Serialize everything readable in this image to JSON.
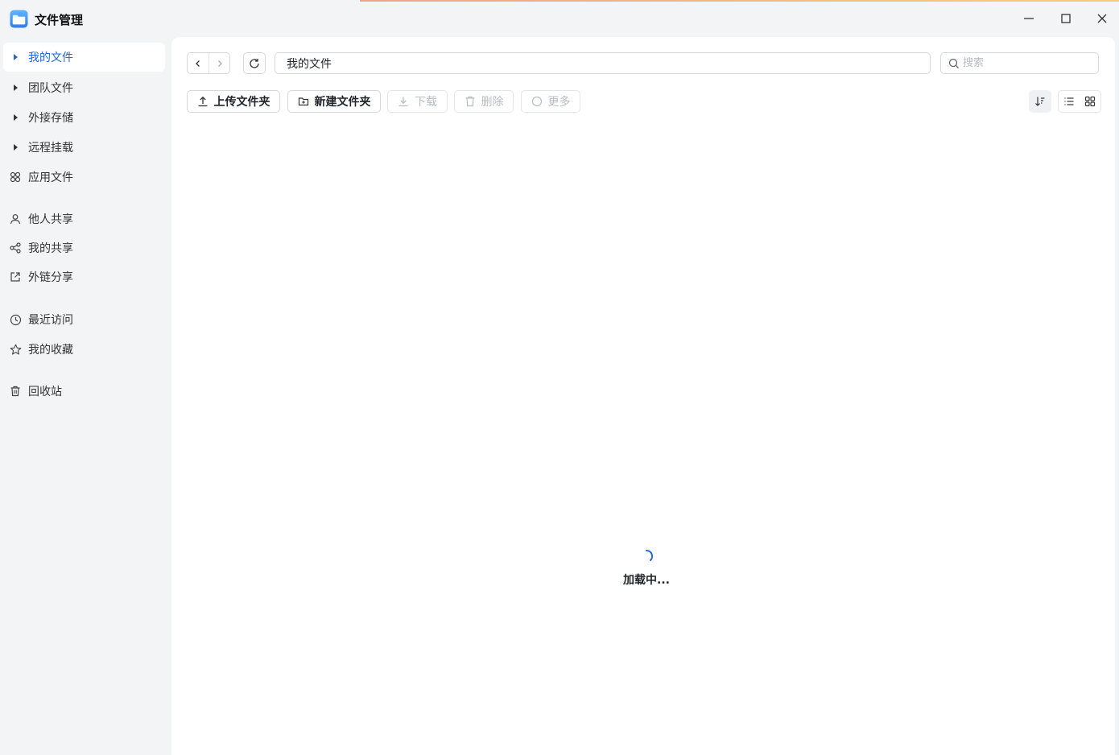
{
  "window": {
    "title": "文件管理",
    "app_icon": "folder-app-icon",
    "controls": {
      "minimize": "minimize-icon",
      "maximize": "maximize-icon",
      "close": "close-icon"
    },
    "accent_color": "#1e66e6"
  },
  "sidebar": {
    "items": [
      {
        "label": "我的文件",
        "icon": "caret-right-icon",
        "active": true
      },
      {
        "label": "团队文件",
        "icon": "caret-right-icon"
      },
      {
        "label": "外接存储",
        "icon": "caret-right-icon"
      },
      {
        "label": "远程挂载",
        "icon": "caret-right-icon"
      },
      {
        "label": "应用文件",
        "icon": "apps-icon"
      },
      {
        "label": "他人共享",
        "icon": "user-icon"
      },
      {
        "label": "我的共享",
        "icon": "share-icon"
      },
      {
        "label": "外链分享",
        "icon": "external-link-icon"
      },
      {
        "label": "最近访问",
        "icon": "clock-icon"
      },
      {
        "label": "我的收藏",
        "icon": "star-icon"
      },
      {
        "label": "回收站",
        "icon": "trash-icon"
      }
    ]
  },
  "toolbar": {
    "path": "我的文件",
    "search_placeholder": "搜索",
    "upload_folder": "上传文件夹",
    "new_folder": "新建文件夹",
    "download": "下载",
    "delete": "删除",
    "more": "更多"
  },
  "content": {
    "loading_text": "加载中..."
  }
}
